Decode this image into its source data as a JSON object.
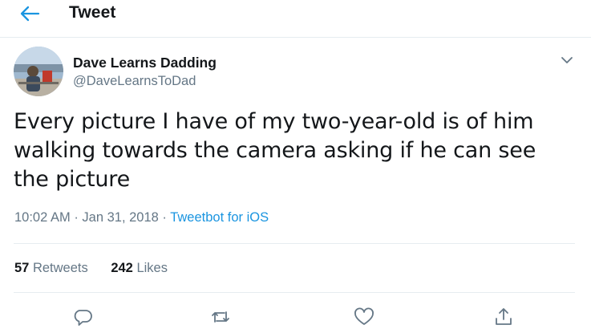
{
  "header": {
    "title": "Tweet",
    "back_icon": "arrow-left-icon"
  },
  "author": {
    "name": "Dave Learns Dadding",
    "handle": "@DaveLearnsToDad"
  },
  "tweet": {
    "text": "Every picture I have of my two-year-old is of him walking towards the camera asking if he can see the picture",
    "time": "10:02 AM",
    "separator": "·",
    "date": "Jan 31, 2018",
    "source": "Tweetbot for iOS"
  },
  "stats": {
    "retweets_count": "57",
    "retweets_label": "Retweets",
    "likes_count": "242",
    "likes_label": "Likes"
  },
  "actions": [
    "reply-icon",
    "retweet-icon",
    "like-icon",
    "share-icon"
  ],
  "colors": {
    "accent": "#1b95e0",
    "secondary_text": "#657786",
    "primary_text": "#14171a",
    "border": "#e6ecf0"
  }
}
